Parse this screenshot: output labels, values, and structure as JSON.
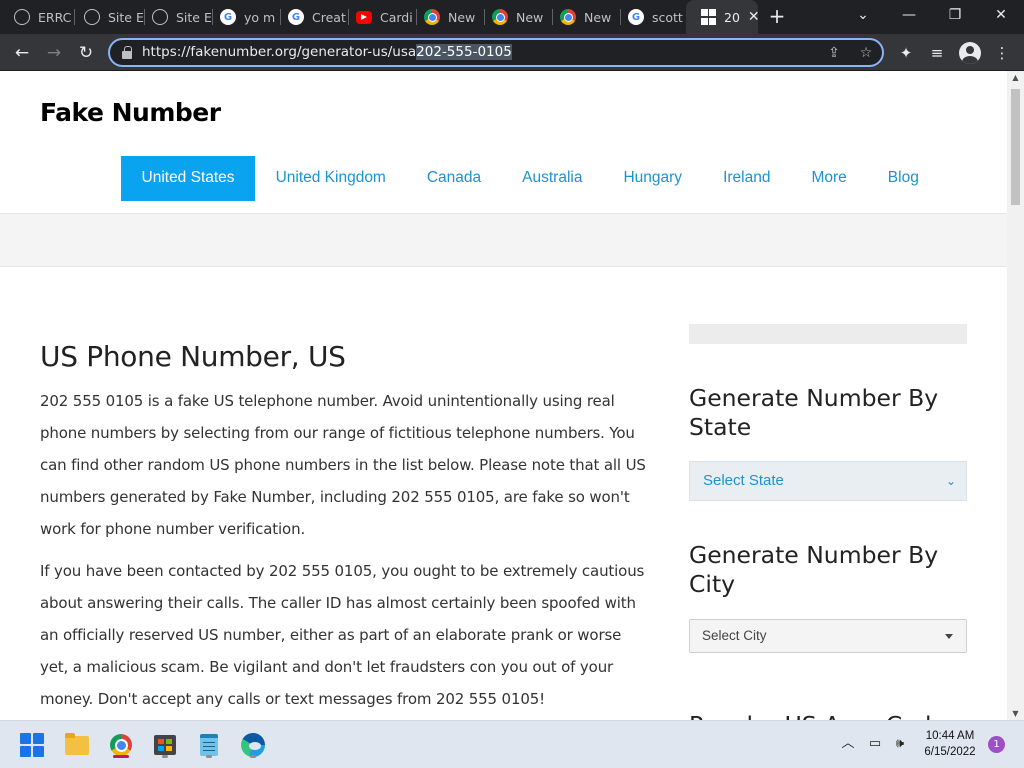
{
  "browser": {
    "tabs": [
      {
        "title": "ERRC",
        "favicon": "globe-icon"
      },
      {
        "title": "Site E",
        "favicon": "globe-icon"
      },
      {
        "title": "Site E",
        "favicon": "globe-icon"
      },
      {
        "title": "yo m",
        "favicon": "google-icon"
      },
      {
        "title": "Creat",
        "favicon": "google-icon"
      },
      {
        "title": "Cardi",
        "favicon": "youtube-icon"
      },
      {
        "title": "New",
        "favicon": "chrome-icon"
      },
      {
        "title": "New",
        "favicon": "chrome-icon"
      },
      {
        "title": "New",
        "favicon": "chrome-icon"
      },
      {
        "title": "scott",
        "favicon": "google-icon"
      },
      {
        "title": "20",
        "favicon": "fakenumber-icon",
        "active": true
      }
    ],
    "url_prefix": "https://fakenumber.org/generator-us/usa",
    "url_selected": "202-555-0105",
    "colors": {
      "accent": "#8ab4f8",
      "tabbar": "#202124",
      "toolbar": "#35363a"
    }
  },
  "site": {
    "logo": "Fake Number",
    "nav": [
      "United States",
      "United Kingdom",
      "Canada",
      "Australia",
      "Hungary",
      "Ireland",
      "More",
      "Blog"
    ],
    "active_nav": "United States",
    "colors": {
      "nav_link": "#1c93d1",
      "nav_active_bg": "#0aa3f0"
    }
  },
  "article": {
    "title": "US Phone Number, US",
    "paragraphs": [
      "202 555 0105 is a fake US telephone number. Avoid unintentionally using real phone numbers by selecting from our range of fictitious telephone numbers. You can find other random US phone numbers in the list below. Please note that all US numbers generated by Fake Number, including 202 555 0105, are fake so won't work for phone number verification.",
      "If you have been contacted by 202 555 0105, you ought to be extremely cautious about answering their calls. The caller ID has almost certainly been spoofed with an officially reserved US number, either as part of an elaborate prank or worse yet, a malicious scam. Be vigilant and don't let fraudsters con you out of your money. Don't accept any calls or text messages from 202 555 0105!"
    ]
  },
  "sidebar": {
    "heading_state": "Generate Number By State",
    "select_state": "Select State",
    "heading_city": "Generate Number By City",
    "select_city": "Select City",
    "heading_popular": "Popular US Area Codes"
  },
  "taskbar": {
    "apps": [
      "start-icon",
      "file-explorer-icon",
      "chrome-icon",
      "store-icon",
      "notepad-icon",
      "edge-icon"
    ],
    "time": "10:44 AM",
    "date": "6/15/2022",
    "notifications": "1"
  }
}
